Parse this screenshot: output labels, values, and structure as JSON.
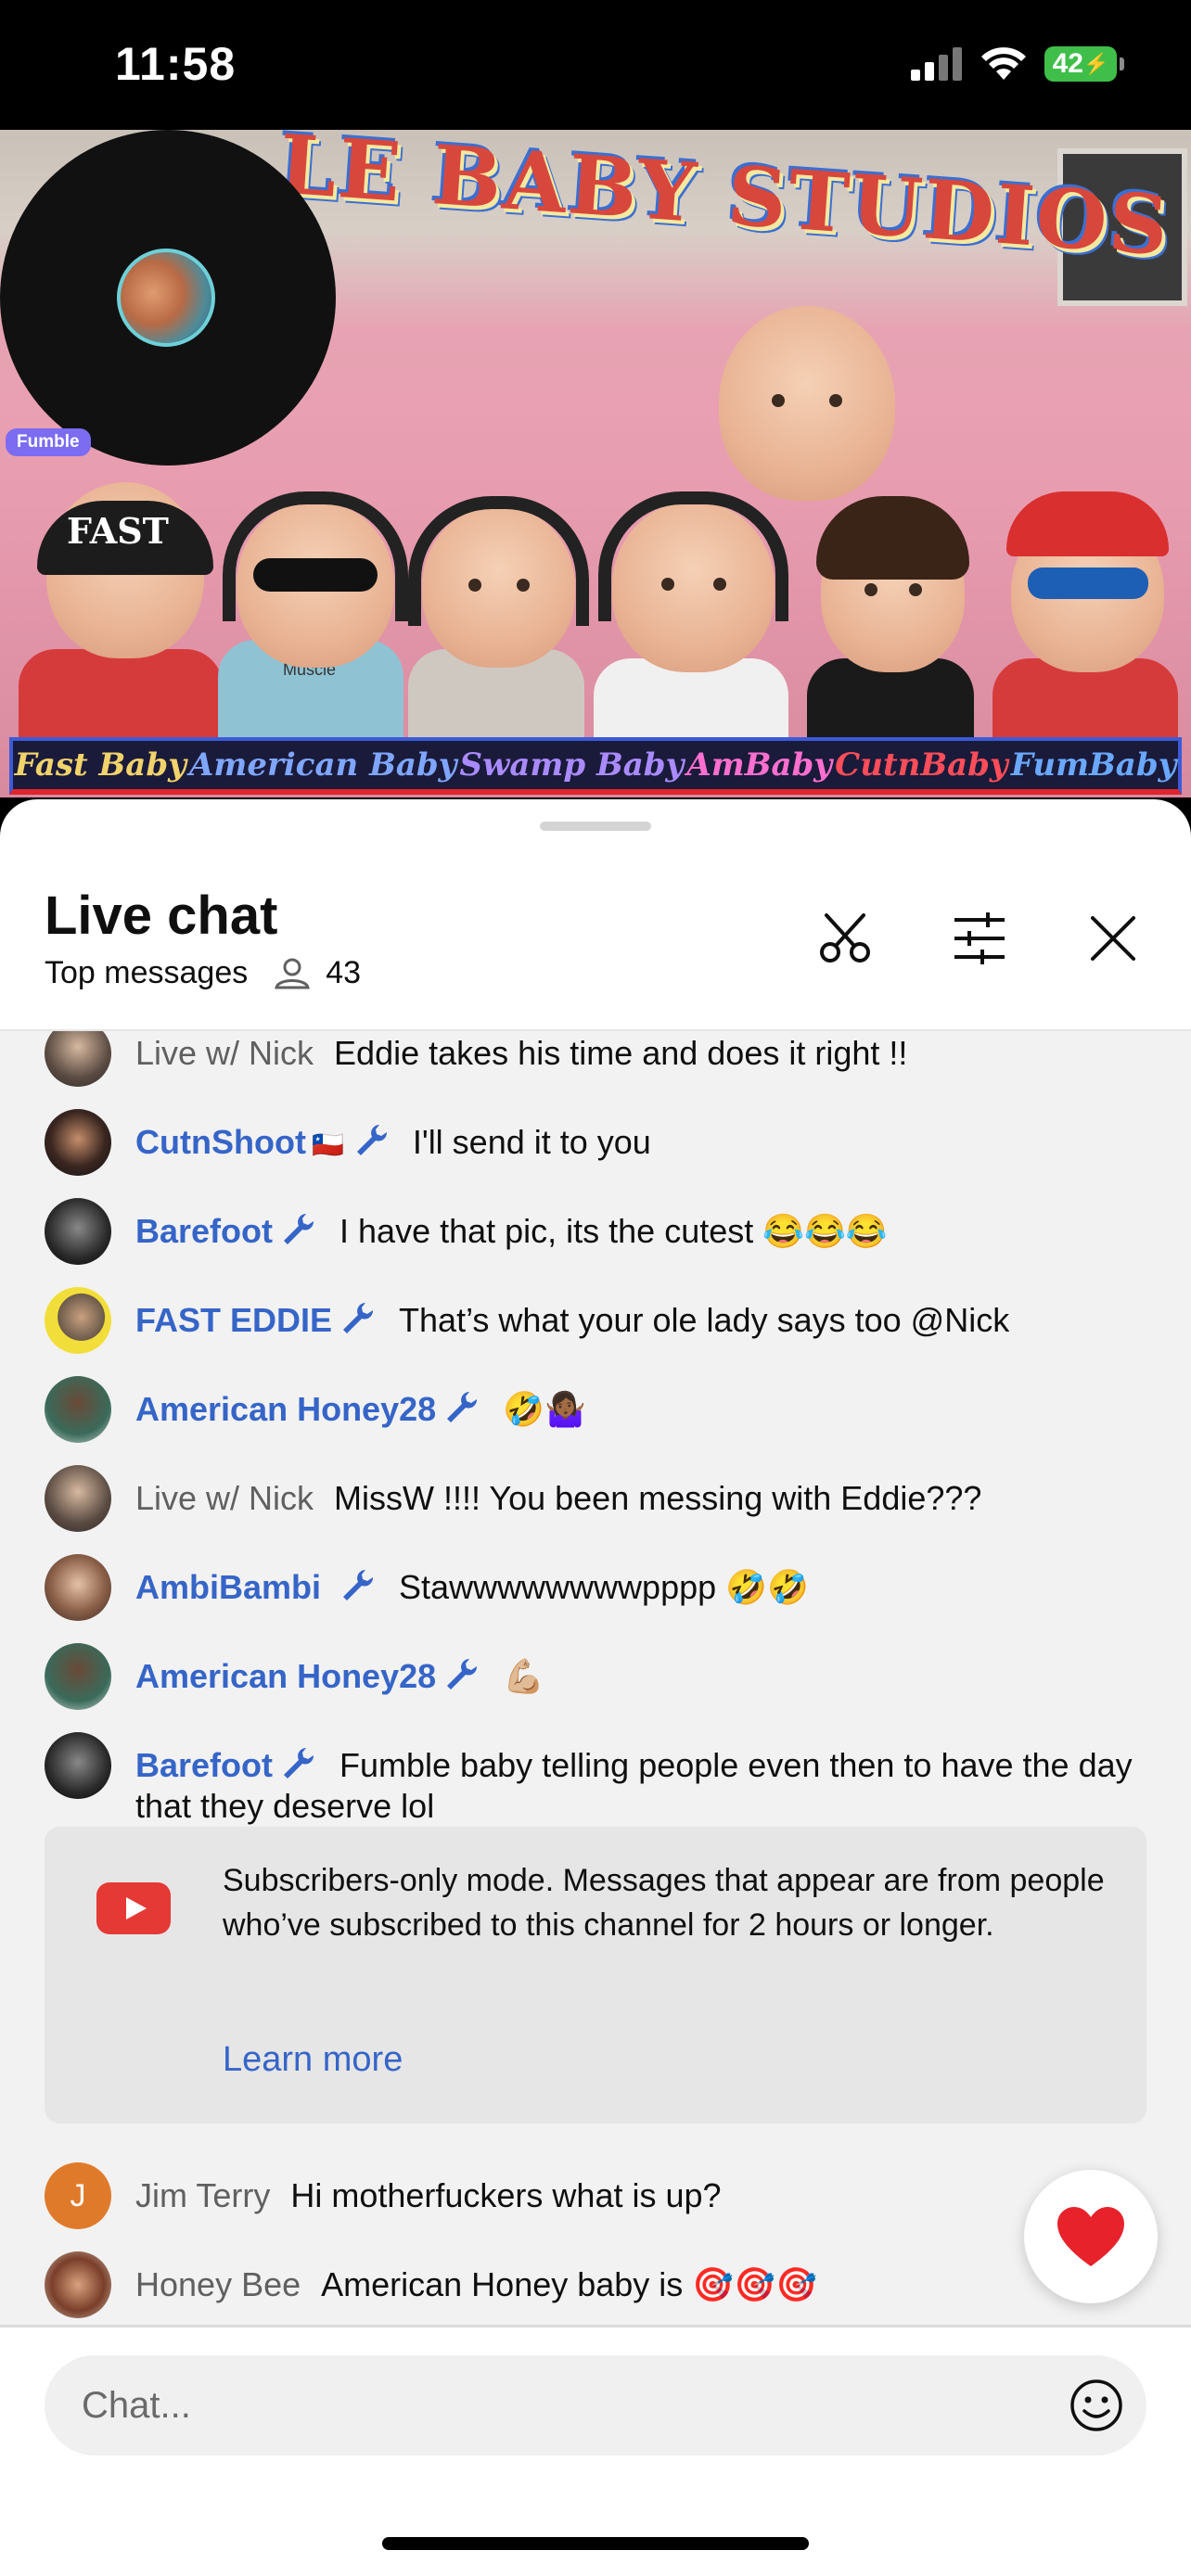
{
  "status_bar": {
    "time": "11:58",
    "battery": "42"
  },
  "video": {
    "studio_banner": "LE BABY STUDIOS",
    "baby_names": [
      "Fast Baby",
      "American Baby",
      "Swamp Baby",
      "AmBaby",
      "CutnBaby",
      "FumBaby"
    ],
    "cap_text": "FAST",
    "shirt_text": "Muscle",
    "pip_tag": "Fumble"
  },
  "chat": {
    "title": "Live chat",
    "mode": "Top messages",
    "viewer_count": "43",
    "messages": [
      {
        "author": "Live w/ Nick",
        "text": "Eddie takes his time and does it right !!"
      },
      {
        "author": "CutnShoot",
        "flag": "🇨🇱",
        "text": "I'll send it to you"
      },
      {
        "author": "Barefoot",
        "text": "I have that pic, its the cutest 😂😂😂"
      },
      {
        "author": "FAST EDDIE",
        "text": "That’s what your ole lady says too @Nick"
      },
      {
        "author": "American Honey28",
        "text": "🤣🤷🏾‍♀️"
      },
      {
        "author": "Live w/ Nick",
        "text": "MissW !!!! You been messing with Eddie???"
      },
      {
        "author": "AmbiBambi",
        "text": "Stawwwwwwwwpppp 🤣🤣"
      },
      {
        "author": "American Honey28",
        "text": "💪🏼"
      },
      {
        "author": "Barefoot",
        "text": "Fumble baby telling people even then to have the day that they deserve lol"
      },
      {
        "author": "Jim Terry",
        "avatar_letter": "J",
        "text": "Hi motherfuckers what is up?"
      },
      {
        "author": "Honey Bee",
        "text": "American Honey baby is 🎯🎯🎯"
      }
    ],
    "notice": {
      "text": "Subscribers-only mode. Messages that appear are from people who’ve subscribed to this channel for 2 hours or longer.",
      "link": "Learn more"
    },
    "input_placeholder": "Chat...",
    "heart": "❤️"
  },
  "colors": {
    "author_blue": "#3665c8",
    "youtube_red": "#e53935",
    "battery_green": "#3fbf4a",
    "pip_tag": "#7b6cf2"
  }
}
